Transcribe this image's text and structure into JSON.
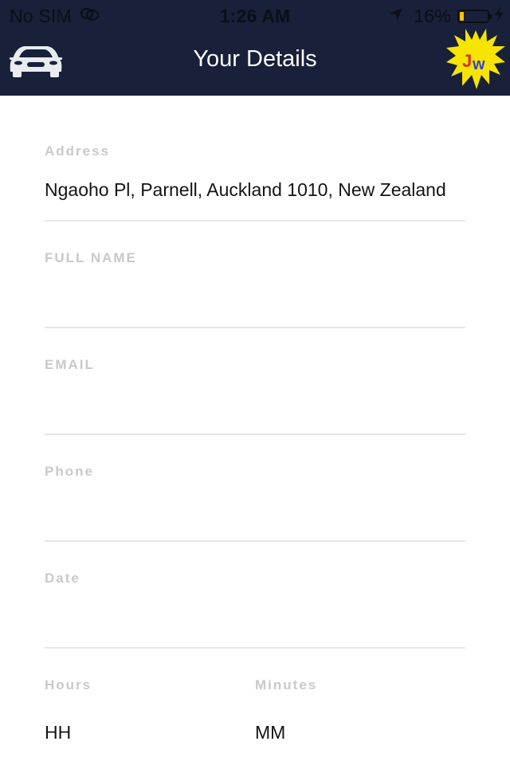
{
  "status_bar": {
    "carrier": "No SIM",
    "time": "1:26 AM",
    "battery_percent": "16%",
    "battery_level": 0.16,
    "icons": [
      "wifi-link-icon",
      "location-arrow-icon",
      "battery-icon",
      "charging-bolt-icon"
    ]
  },
  "header": {
    "title": "Your Details",
    "logo_text": "Jw",
    "left_icon": "car-icon",
    "colors": {
      "header_bg": "#18203a",
      "logo_splat": "#f7e400",
      "logo_j": "#d4322b",
      "logo_w": "#2f46c8"
    }
  },
  "form": {
    "address": {
      "label": "Address",
      "value": "Ngaoho Pl, Parnell, Auckland 1010, New Zealand"
    },
    "full_name": {
      "label": "FULL NAME",
      "value": ""
    },
    "email": {
      "label": "EMAIL",
      "value": ""
    },
    "phone": {
      "label": "Phone",
      "value": ""
    },
    "date": {
      "label": "Date",
      "value": ""
    },
    "hours": {
      "label": "Hours",
      "value": "HH"
    },
    "minutes": {
      "label": "Minutes",
      "value": "MM"
    }
  }
}
